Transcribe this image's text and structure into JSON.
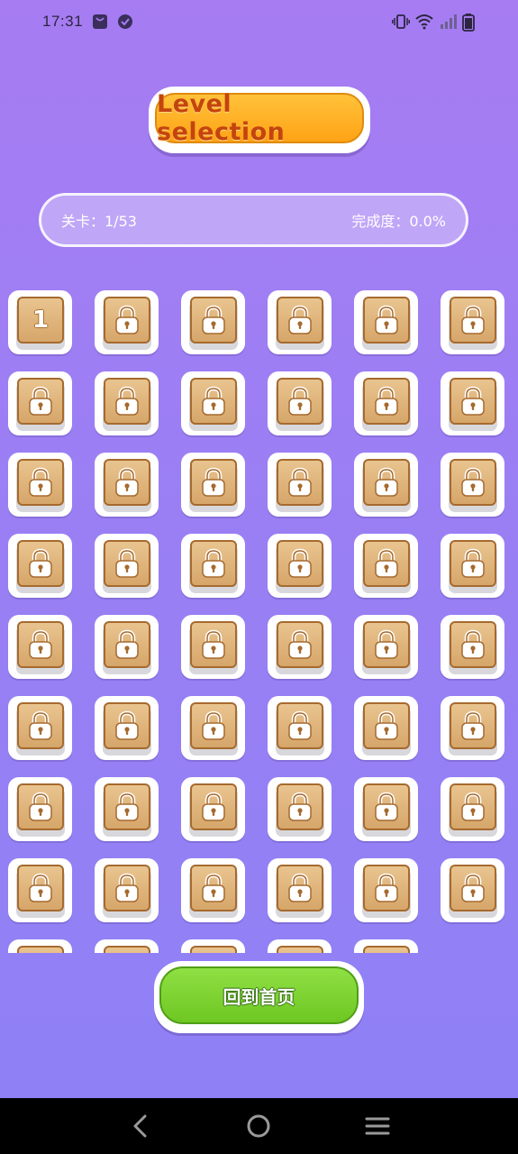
{
  "status_bar": {
    "time": "17:31",
    "icons": [
      "bag-icon",
      "check-badge-icon",
      "vibrate-icon",
      "wifi-icon",
      "signal-icon",
      "battery-icon"
    ]
  },
  "title": "Level selection",
  "progress": {
    "level_text": "关卡：1/53",
    "completion_text": "完成度：0.0%"
  },
  "levels": {
    "total": 53,
    "unlocked": [
      1
    ],
    "unlocked_label": "1",
    "locked_icon": "lock-icon"
  },
  "home_button": {
    "label": "回到首页"
  },
  "nav": {
    "back": "back-icon",
    "home": "home-circle-icon",
    "menu": "menu-icon"
  },
  "colors": {
    "background_top": "#a77cf2",
    "background_bottom": "#8e80f6",
    "title_orange": "#ffa316",
    "title_text": "#c4440e",
    "tile_face": "#e0b47c",
    "home_green": "#7dd233"
  }
}
